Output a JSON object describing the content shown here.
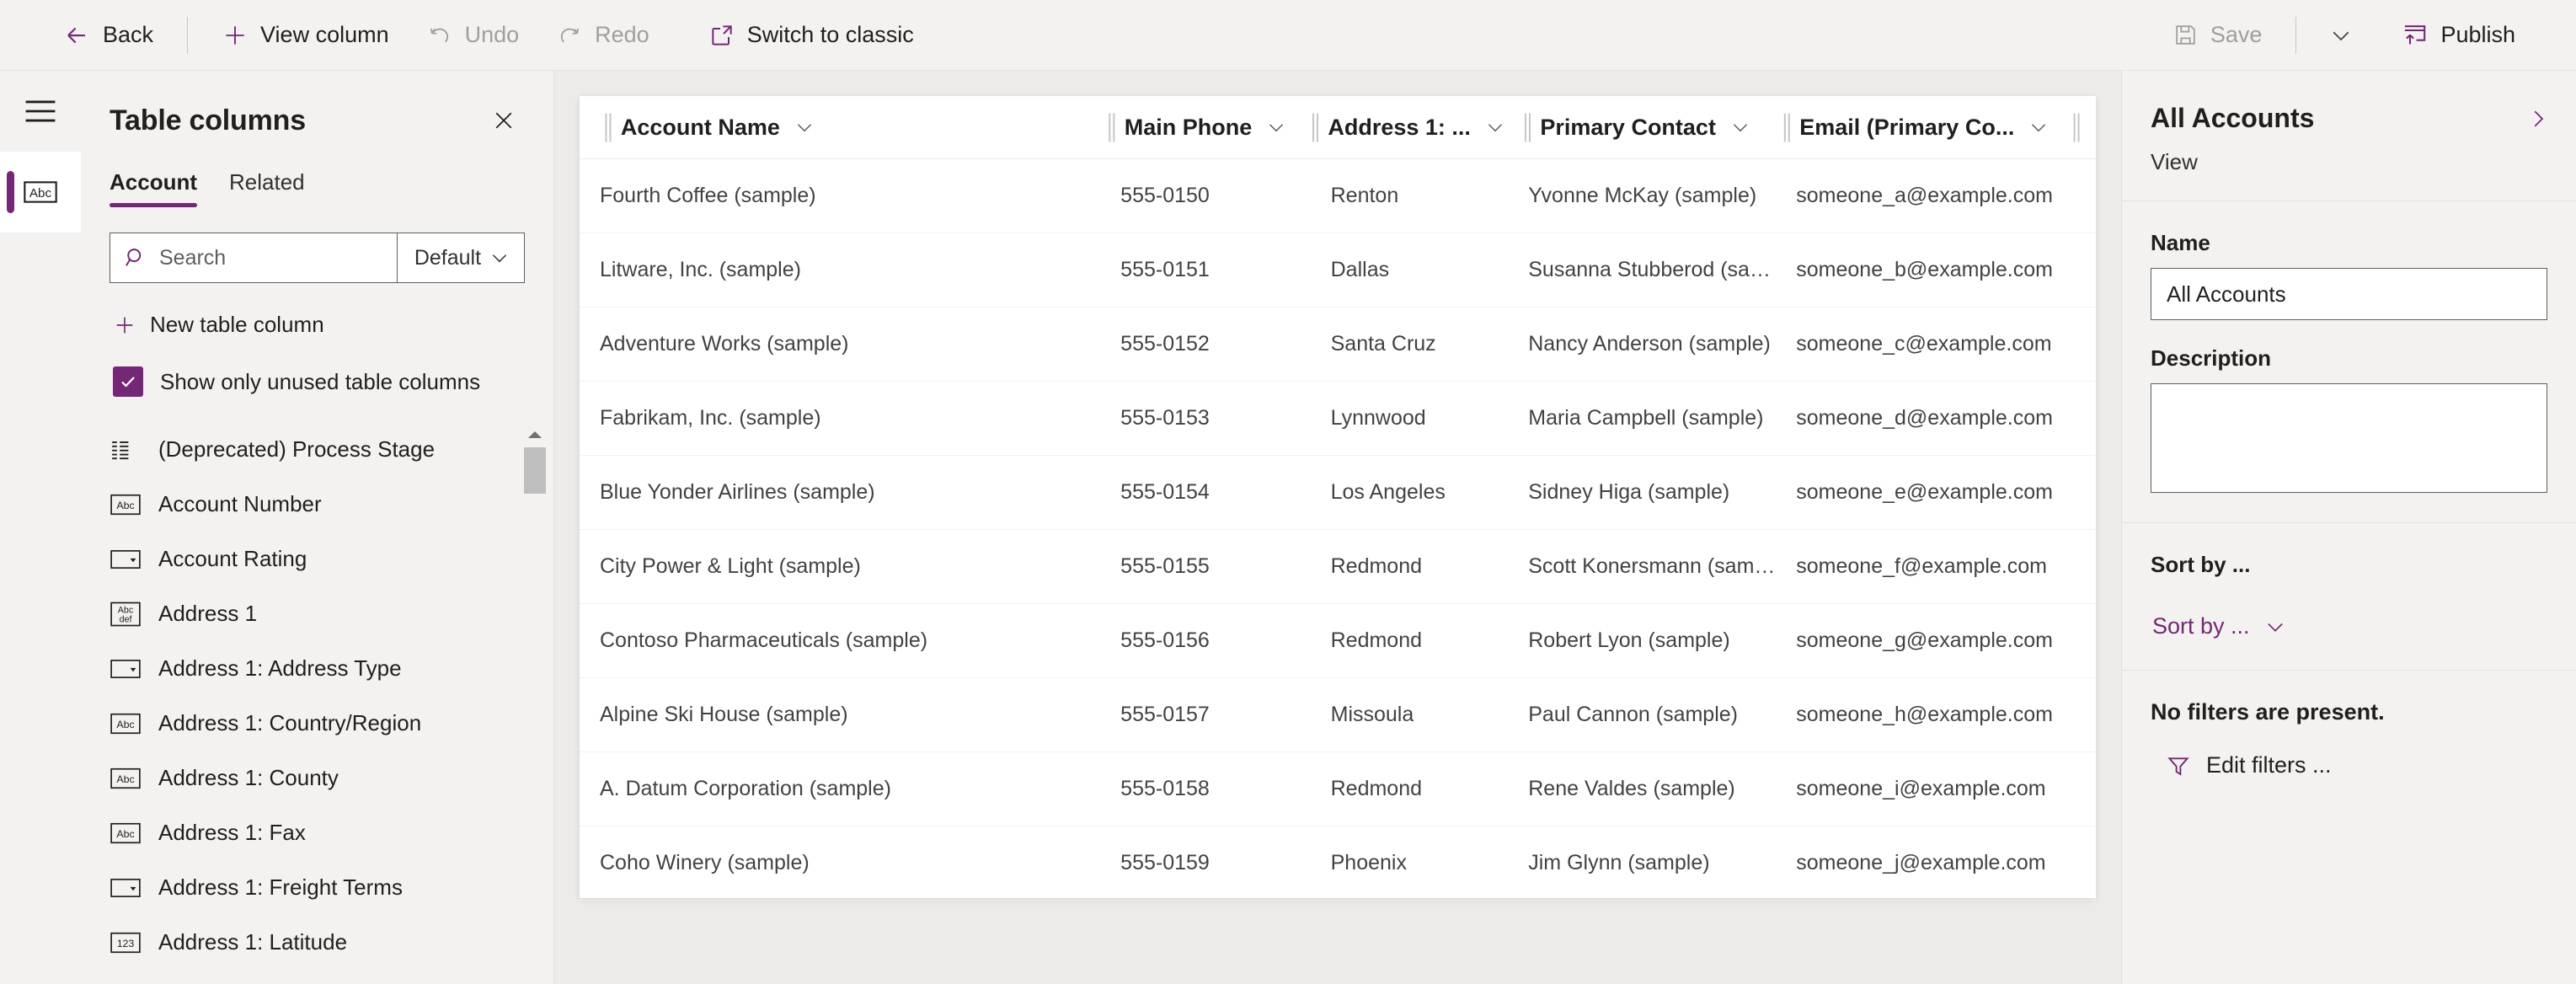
{
  "colors": {
    "accent": "#742774",
    "panel_bg": "#f3f2f1",
    "canvas_bg": "#edebe9",
    "text": "#201f1e",
    "disabled": "#a19f9d"
  },
  "commandbar": {
    "back": "Back",
    "view_column": "View column",
    "undo": "Undo",
    "redo": "Redo",
    "switch_to_classic": "Switch to classic",
    "save": "Save",
    "publish": "Publish"
  },
  "rail": {
    "menu_icon": "hamburger-icon",
    "items": [
      {
        "icon": "abc-text-icon",
        "active": true
      }
    ]
  },
  "columns_panel": {
    "title": "Table columns",
    "close_icon": "close-icon",
    "tabs": [
      {
        "label": "Account",
        "active": true
      },
      {
        "label": "Related",
        "active": false
      }
    ],
    "search": {
      "placeholder": "Search",
      "value": "",
      "icon": "search-icon"
    },
    "filter_select": {
      "value": "Default",
      "icon": "chevron-down-icon"
    },
    "new_column": {
      "label": "New table column",
      "icon": "plus-icon"
    },
    "show_unused": {
      "label": "Show only unused table columns",
      "checked": true
    },
    "list": [
      {
        "label": "(Deprecated) Process Stage",
        "icon": "list-lines-icon"
      },
      {
        "label": "Account Number",
        "icon": "abc-icon"
      },
      {
        "label": "Account Rating",
        "icon": "optionset-icon"
      },
      {
        "label": "Address 1",
        "icon": "abcdef-icon"
      },
      {
        "label": "Address 1: Address Type",
        "icon": "optionset-icon"
      },
      {
        "label": "Address 1: Country/Region",
        "icon": "abc-icon"
      },
      {
        "label": "Address 1: County",
        "icon": "abc-icon"
      },
      {
        "label": "Address 1: Fax",
        "icon": "abc-icon"
      },
      {
        "label": "Address 1: Freight Terms",
        "icon": "optionset-icon"
      },
      {
        "label": "Address 1: Latitude",
        "icon": "number-123-icon"
      }
    ],
    "scrollbar": {
      "up_icon": "scroll-up-arrow-icon"
    }
  },
  "grid": {
    "headers": [
      {
        "label": "Account Name"
      },
      {
        "label": "Main Phone"
      },
      {
        "label": "Address 1: ..."
      },
      {
        "label": "Primary Contact"
      },
      {
        "label": "Email (Primary Co..."
      }
    ],
    "rows": [
      {
        "account": "Fourth Coffee (sample)",
        "phone": "555-0150",
        "city": "Renton",
        "contact": "Yvonne McKay (sample)",
        "email": "someone_a@example.com"
      },
      {
        "account": "Litware, Inc. (sample)",
        "phone": "555-0151",
        "city": "Dallas",
        "contact": "Susanna Stubberod (samp...",
        "email": "someone_b@example.com"
      },
      {
        "account": "Adventure Works (sample)",
        "phone": "555-0152",
        "city": "Santa Cruz",
        "contact": "Nancy Anderson (sample)",
        "email": "someone_c@example.com"
      },
      {
        "account": "Fabrikam, Inc. (sample)",
        "phone": "555-0153",
        "city": "Lynnwood",
        "contact": "Maria Campbell (sample)",
        "email": "someone_d@example.com"
      },
      {
        "account": "Blue Yonder Airlines (sample)",
        "phone": "555-0154",
        "city": "Los Angeles",
        "contact": "Sidney Higa (sample)",
        "email": "someone_e@example.com"
      },
      {
        "account": "City Power & Light (sample)",
        "phone": "555-0155",
        "city": "Redmond",
        "contact": "Scott Konersmann (sample)",
        "email": "someone_f@example.com"
      },
      {
        "account": "Contoso Pharmaceuticals (sample)",
        "phone": "555-0156",
        "city": "Redmond",
        "contact": "Robert Lyon (sample)",
        "email": "someone_g@example.com"
      },
      {
        "account": "Alpine Ski House (sample)",
        "phone": "555-0157",
        "city": "Missoula",
        "contact": "Paul Cannon (sample)",
        "email": "someone_h@example.com"
      },
      {
        "account": "A. Datum Corporation (sample)",
        "phone": "555-0158",
        "city": "Redmond",
        "contact": "Rene Valdes (sample)",
        "email": "someone_i@example.com"
      },
      {
        "account": "Coho Winery (sample)",
        "phone": "555-0159",
        "city": "Phoenix",
        "contact": "Jim Glynn (sample)",
        "email": "someone_j@example.com"
      }
    ]
  },
  "properties": {
    "title": "All Accounts",
    "subtitle": "View",
    "expand_icon": "chevron-right-icon",
    "name_label": "Name",
    "name_value": "All Accounts",
    "description_label": "Description",
    "description_value": "",
    "sort_section_label": "Sort by ...",
    "sort_link_label": "Sort by ...",
    "no_filters_text": "No filters are present.",
    "edit_filters_label": "Edit filters ...",
    "filter_icon": "funnel-icon"
  }
}
